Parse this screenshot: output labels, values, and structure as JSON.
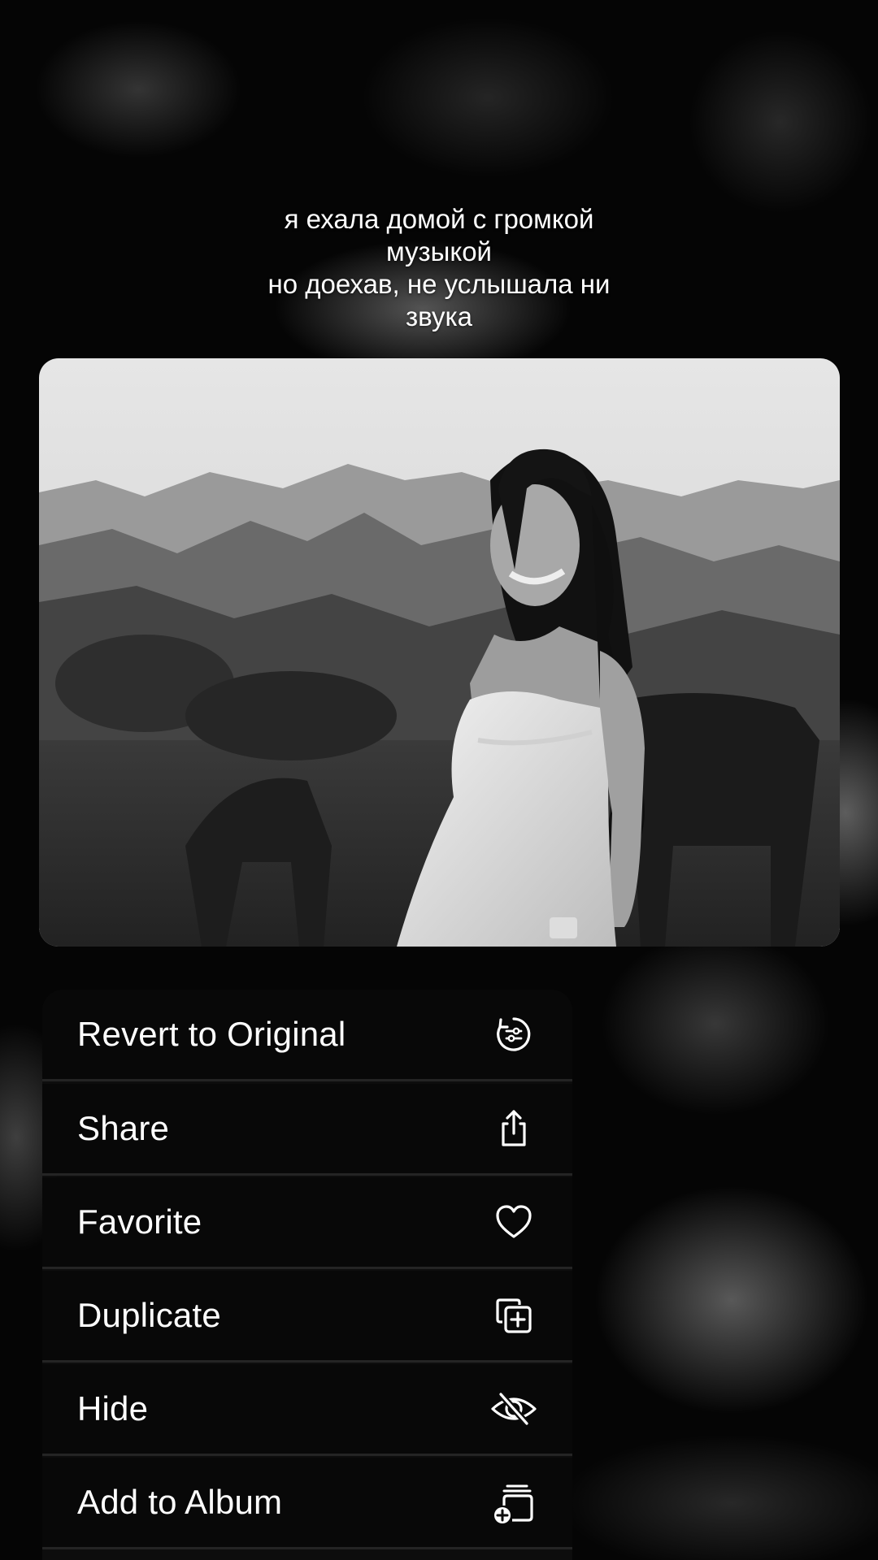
{
  "caption": {
    "lines": [
      "я ехала домой с громкой",
      "музыкой",
      "но доехав, не услышала ни",
      "звука"
    ]
  },
  "photo": {
    "description_icon": "photo-preview"
  },
  "menu": {
    "items": [
      {
        "label": "Revert to Original",
        "icon": "revert-icon"
      },
      {
        "label": "Share",
        "icon": "share-icon"
      },
      {
        "label": "Favorite",
        "icon": "heart-icon"
      },
      {
        "label": "Duplicate",
        "icon": "duplicate-icon"
      },
      {
        "label": "Hide",
        "icon": "eye-slash-icon"
      },
      {
        "label": "Add to Album",
        "icon": "add-to-album-icon"
      }
    ]
  },
  "colors": {
    "menu_background": "#0e0e0e",
    "separator": "#242424",
    "text": "#ffffff"
  }
}
